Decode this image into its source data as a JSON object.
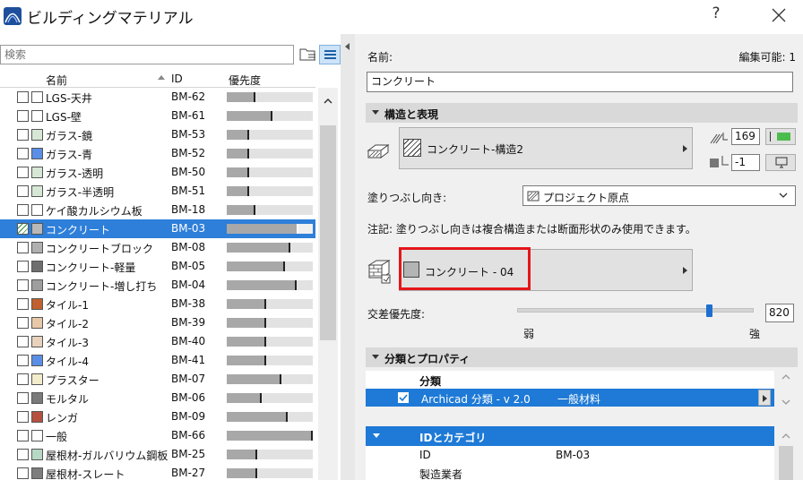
{
  "window": {
    "title": "ビルディングマテリアル",
    "help_label": "?"
  },
  "left": {
    "search_placeholder": "検索",
    "columns": {
      "name": "名前",
      "id": "ID",
      "priority": "優先度"
    },
    "rows": [
      {
        "name": "LGS-天井",
        "id": "BM-62",
        "priority": 0.31,
        "swatch": "#ffffff",
        "selected": false
      },
      {
        "name": "LGS-壁",
        "id": "BM-61",
        "priority": 0.51,
        "swatch": "#ffffff",
        "selected": false
      },
      {
        "name": "ガラス-鏡",
        "id": "BM-53",
        "priority": 0.24,
        "swatch": "#d6e7d6",
        "selected": false
      },
      {
        "name": "ガラス-青",
        "id": "BM-52",
        "priority": 0.24,
        "swatch": "#5b8ee6",
        "selected": false
      },
      {
        "name": "ガラス-透明",
        "id": "BM-50",
        "priority": 0.24,
        "swatch": "#d6e7d6",
        "selected": false
      },
      {
        "name": "ガラス-半透明",
        "id": "BM-51",
        "priority": 0.24,
        "swatch": "#d6e7d6",
        "selected": false
      },
      {
        "name": "ケイ酸カルシウム板",
        "id": "BM-18",
        "priority": 0.31,
        "swatch": "#ffffff",
        "selected": false
      },
      {
        "name": "コンクリート",
        "id": "BM-03",
        "priority": 0.81,
        "swatch": "#b8b8b8",
        "selected": true
      },
      {
        "name": "コンクリートブロック",
        "id": "BM-08",
        "priority": 0.72,
        "swatch": "#b0b0b0",
        "selected": false
      },
      {
        "name": "コンクリート-軽量",
        "id": "BM-05",
        "priority": 0.66,
        "swatch": "#6e6e6e",
        "selected": false
      },
      {
        "name": "コンクリート-増し打ち",
        "id": "BM-04",
        "priority": 0.79,
        "swatch": "#9e9e9e",
        "selected": false
      },
      {
        "name": "タイル-1",
        "id": "BM-38",
        "priority": 0.44,
        "swatch": "#c0612f",
        "selected": false
      },
      {
        "name": "タイル-2",
        "id": "BM-39",
        "priority": 0.44,
        "swatch": "#e7c8a8",
        "selected": false
      },
      {
        "name": "タイル-3",
        "id": "BM-40",
        "priority": 0.44,
        "swatch": "#e8d2bd",
        "selected": false
      },
      {
        "name": "タイル-4",
        "id": "BM-41",
        "priority": 0.44,
        "swatch": "#5b8ee6",
        "selected": false
      },
      {
        "name": "プラスター",
        "id": "BM-07",
        "priority": 0.61,
        "swatch": "#f2eccc",
        "selected": false
      },
      {
        "name": "モルタル",
        "id": "BM-06",
        "priority": 0.39,
        "swatch": "#7a7a7a",
        "selected": false
      },
      {
        "name": "レンガ",
        "id": "BM-09",
        "priority": 0.69,
        "swatch": "#b55040",
        "selected": false
      },
      {
        "name": "一般",
        "id": "BM-66",
        "priority": 1.0,
        "swatch": "#ffffff",
        "selected": false
      },
      {
        "name": "屋根材-ガルバリウム鋼板",
        "id": "BM-25",
        "priority": 0.33,
        "swatch": "#b7d8c4",
        "selected": false
      },
      {
        "name": "屋根材-スレート",
        "id": "BM-27",
        "priority": 0.33,
        "swatch": "#7d7d7d",
        "selected": false
      }
    ]
  },
  "right": {
    "name_label": "名前:",
    "editable_label": "編集可能: 1",
    "name_value": "コンクリート",
    "section_structure": "構造と表現",
    "cut_fill": "コンクリート-構造2",
    "pen_value": "169",
    "bg_pen_value": "-1",
    "fill_orientation_label": "塗りつぶし向き:",
    "fill_orientation_value": "プロジェクト原点",
    "note": "注記: 塗りつぶし向きは複合構造または断面形状のみ使用できます。",
    "surface": "コンクリート - 04",
    "intersection_label": "交差優先度:",
    "intersection_value": "820",
    "intersection_fraction": 0.81,
    "weak_label": "弱",
    "strong_label": "強",
    "section_classification": "分類とプロパティ",
    "class_header": "分類",
    "class_row_system": "Archicad 分類 - v 2.0",
    "class_row_value": "一般材料",
    "id_section": "IDとカテゴリ",
    "id_label": "ID",
    "id_value": "BM-03",
    "manufacturer_label": "製造業者"
  }
}
